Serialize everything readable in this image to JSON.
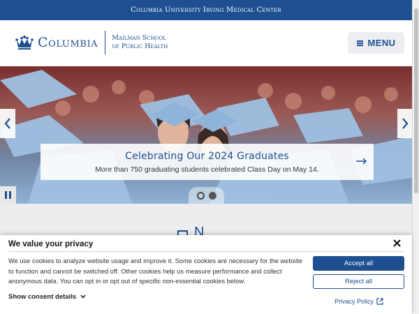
{
  "topbar": {
    "title": "Columbia University Irving Medical Center"
  },
  "header": {
    "logo_word": "Columbia",
    "school_line1": "Mailman School",
    "school_line2": "of Public Health",
    "menu_label": "MENU",
    "icons": {
      "logo": "crown-icon",
      "menu": "hamburger-icon"
    }
  },
  "hero": {
    "caption_title": "Celebrating Our 2024 Graduates",
    "caption_subtitle": "More than 750 graduating students celebrated Class Day on May 14.",
    "icons": {
      "prev": "chevron-left-icon",
      "next": "chevron-right-icon",
      "go": "arrow-right-icon",
      "pause": "pause-icon"
    },
    "slides": {
      "count": 2,
      "active_index": 0
    }
  },
  "below": {
    "heading_fragment": "N"
  },
  "cookie_banner": {
    "title": "We value your privacy",
    "body": "We use cookies to analyze website usage and improve it. Some cookies are necessary for the website to function and cannot be switched off. Other cookies help us measure performance and collect anonymous data. You can opt in or opt out of specific non-essential cookies below.",
    "details_label": "Show consent details",
    "accept_label": "Accept all",
    "reject_label": "Reject all",
    "privacy_label": "Privacy Policy",
    "icons": {
      "close": "close-icon",
      "details": "chevron-down-icon",
      "privacy": "external-link-icon"
    }
  },
  "colors": {
    "brand": "#1d4f91",
    "background": "#ededed",
    "banner": "#ffffff"
  }
}
